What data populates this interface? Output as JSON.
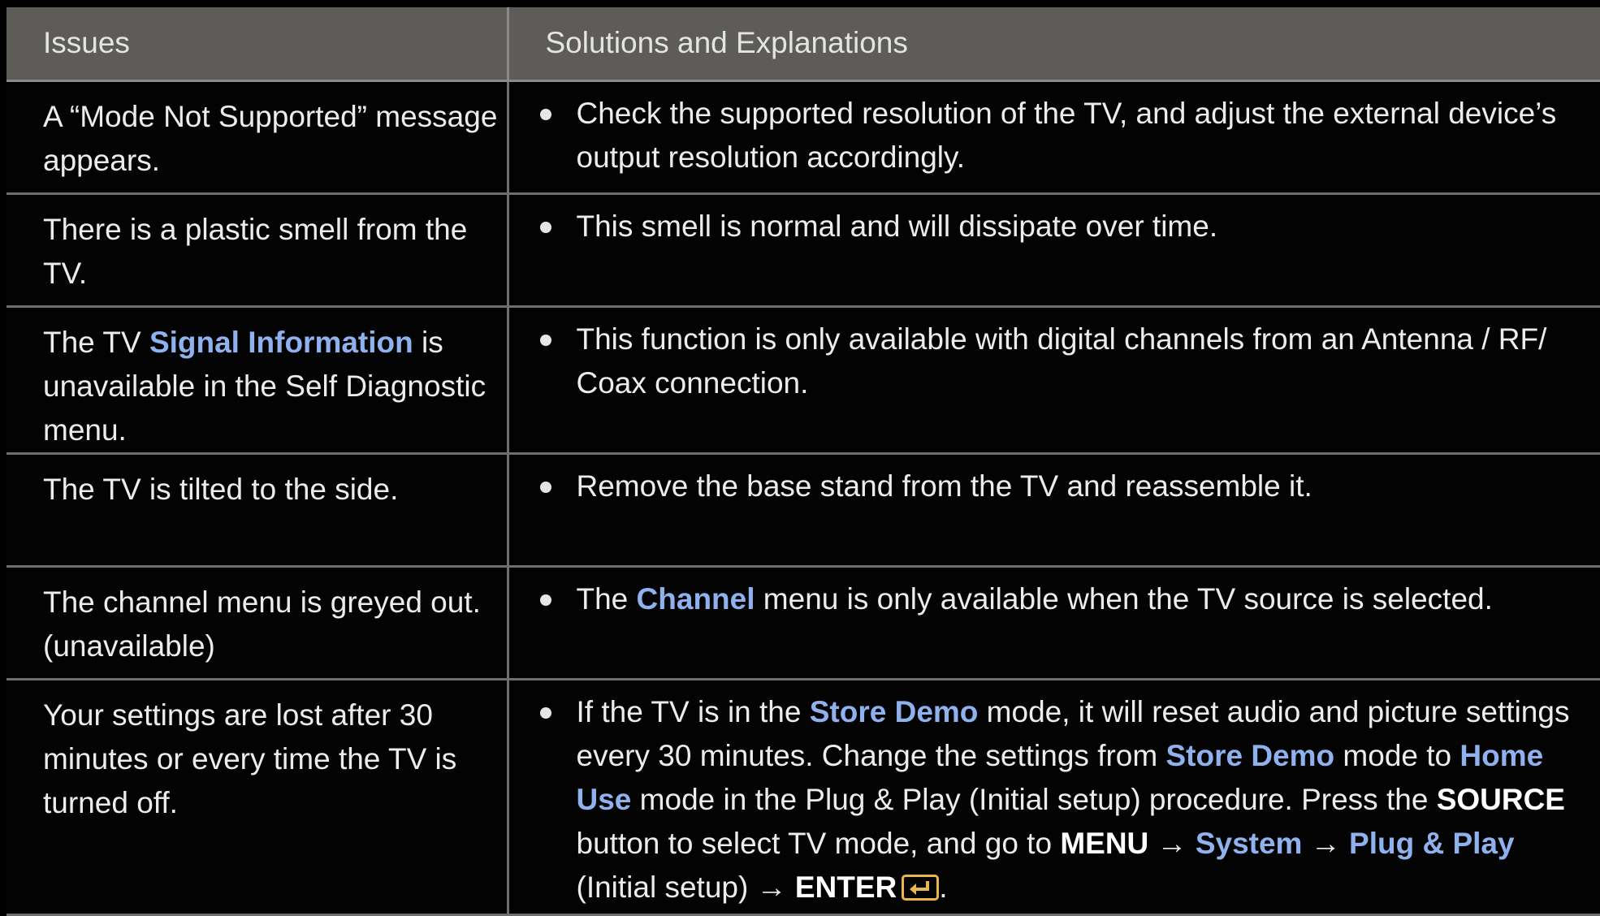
{
  "header": {
    "issues": "Issues",
    "solutions": "Solutions and Explanations"
  },
  "rows": [
    {
      "issue": "A “Mode Not Supported” message appears.",
      "solution_text": "Check the supported resolution of the TV, and adjust the external device’s output resolution accordingly."
    },
    {
      "issue": "There is a plastic smell from the TV.",
      "solution_text": "This smell is normal and will dissipate over time."
    },
    {
      "issue_pre": "The TV ",
      "issue_hl": "Signal Information",
      "issue_post": " is unavailable in the Self Diagnostic menu.",
      "solution_text": "This function is only available with digital channels from an Antenna / RF/ Coax connection."
    },
    {
      "issue": "The TV is tilted to the side.",
      "solution_text": "Remove the base stand from the TV and reassemble it."
    },
    {
      "issue": "The channel menu is greyed out. (unavailable)",
      "solution_pre": "The ",
      "solution_hl": "Channel",
      "solution_post": " menu is only available when the TV source is selected."
    },
    {
      "issue": "Your settings are lost after 30 minutes or every time the TV is turned off.",
      "s1": "If the TV is in the ",
      "s2": "Store Demo",
      "s3": " mode, it will reset audio and picture settings every 30 minutes. Change the settings from ",
      "s4": "Store Demo",
      "s5": " mode to ",
      "s6": "Home Use",
      "s7": " mode in the Plug & Play (Initial setup) procedure. Press the ",
      "s8": "SOURCE",
      "s9": " button to select TV mode, and go to ",
      "s10": "MENU",
      "s11": " → ",
      "s12": "System",
      "s13": " → ",
      "s14": "Plug & Play",
      "s15": " (Initial setup) → ",
      "s16": "ENTER",
      "s17": ".",
      "enter_icon": "enter-icon"
    }
  ],
  "colors": {
    "header_bg": "#5e5c59",
    "highlight": "#8fb2ee",
    "enter_icon": "#e8b64a",
    "background": "#030304"
  }
}
